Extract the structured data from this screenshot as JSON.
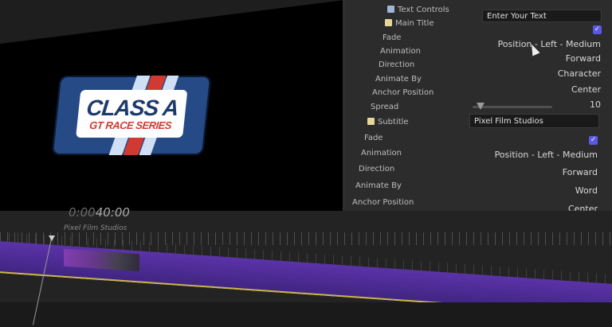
{
  "viewer": {
    "logo_line1": "CLASS A",
    "logo_line2": "GT RACE SERIES"
  },
  "inspector": {
    "text_controls_label": "Text Controls",
    "text_field": "Enter Your Text",
    "main_title_label": "Main Title",
    "main": {
      "fade_label": "Fade",
      "animation_label": "Animation",
      "animation_value": "Position - Left - Medium",
      "direction_label": "Direction",
      "direction_value": "Forward",
      "animate_by_label": "Animate By",
      "animate_by_value": "Character",
      "anchor_label": "Anchor Position",
      "anchor_value": "Center",
      "spread_label": "Spread",
      "spread_value": "10"
    },
    "subtitle_label": "Subtitle",
    "subtitle_field": "Pixel Film Studios",
    "sub": {
      "fade_label": "Fade",
      "animation_label": "Animation",
      "animation_value": "Position - Left - Medium",
      "direction_label": "Direction",
      "direction_value": "Forward",
      "animate_by_label": "Animate By",
      "animate_by_value": "Word",
      "anchor_label": "Anchor Position",
      "anchor_value": "Center"
    },
    "checkmark": "✓",
    "spread_fraction": 0.1
  },
  "timeline": {
    "timecode_dim": "0:00",
    "timecode_bright": "40:00",
    "clip_name": "Pixel Film Studios"
  },
  "colors": {
    "accent_checkbox": "#5959e6",
    "timeline_clip": "#5b33a8",
    "logo_blue": "#264a86",
    "logo_red": "#d13a32"
  }
}
